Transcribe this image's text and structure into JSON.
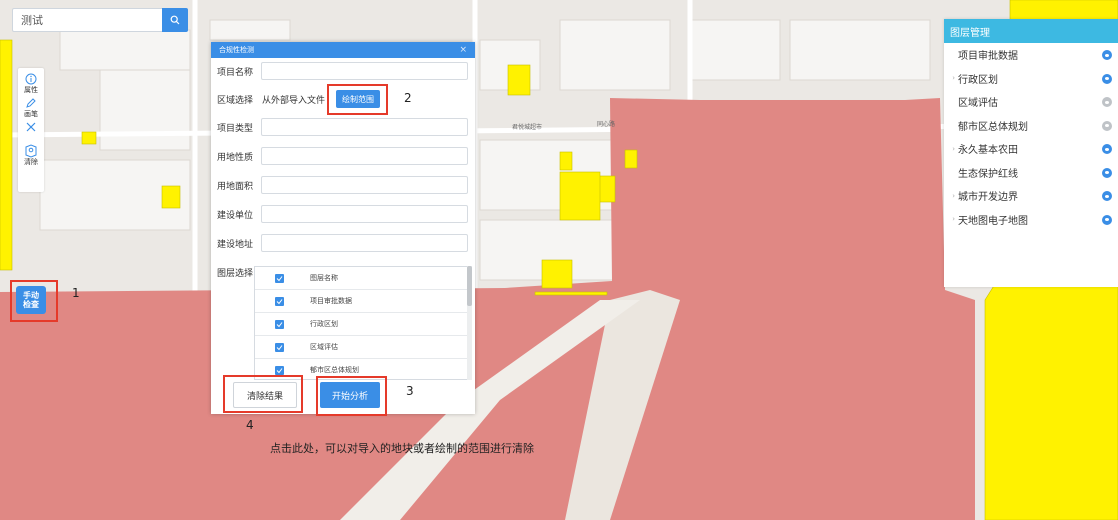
{
  "search": {
    "value": "测试"
  },
  "toolbar": {
    "items": [
      {
        "label": "属性",
        "icon": "info-icon"
      },
      {
        "label": "画笔",
        "icon": "pencil-icon"
      },
      {
        "label": "",
        "icon": "cross-icon"
      },
      {
        "label": "清除",
        "icon": "map-pin-icon"
      }
    ]
  },
  "manual_button": {
    "label": "手动\n检查"
  },
  "dialog": {
    "title": "合规性检测",
    "close": "×",
    "fields": {
      "project_name": "项目名称",
      "region_select": "区域选择",
      "project_type": "项目类型",
      "land_nature": "用地性质",
      "land_area": "用地面积",
      "builder": "建设单位",
      "address": "建设地址",
      "layer_select": "图层选择"
    },
    "import_text": "从外部导入文件",
    "draw_button": "绘制范围",
    "layers": [
      "图层名称",
      "项目审批数据",
      "行政区划",
      "区域评估",
      "郁市区总体规划"
    ],
    "clear_button": "清除结果",
    "analyze_button": "开始分析"
  },
  "annotations": {
    "n1": "1",
    "n2": "2",
    "n3": "3",
    "n4": "4",
    "caption": "点击此处，可以对导入的地块或者绘制的范围进行清除"
  },
  "map_labels": {
    "road": "同心路",
    "place": "君悦城超市"
  },
  "layer_panel": {
    "title": "图层管理",
    "items": [
      {
        "label": "项目审批数据",
        "arrow": false,
        "visible": true
      },
      {
        "label": "行政区划",
        "arrow": true,
        "visible": true
      },
      {
        "label": "区域评估",
        "arrow": false,
        "visible": false
      },
      {
        "label": "郁市区总体规划",
        "arrow": false,
        "visible": false
      },
      {
        "label": "永久基本农田",
        "arrow": true,
        "visible": true
      },
      {
        "label": "生态保护红线",
        "arrow": false,
        "visible": true
      },
      {
        "label": "城市开发边界",
        "arrow": true,
        "visible": true
      },
      {
        "label": "天地图电子地图",
        "arrow": true,
        "visible": true
      }
    ]
  },
  "colors": {
    "accent": "#3a8ee6",
    "panel_header": "#3db9e2",
    "zone_red": "#e08884",
    "zone_yellow": "#fff200",
    "highlight": "#e53a2a"
  }
}
